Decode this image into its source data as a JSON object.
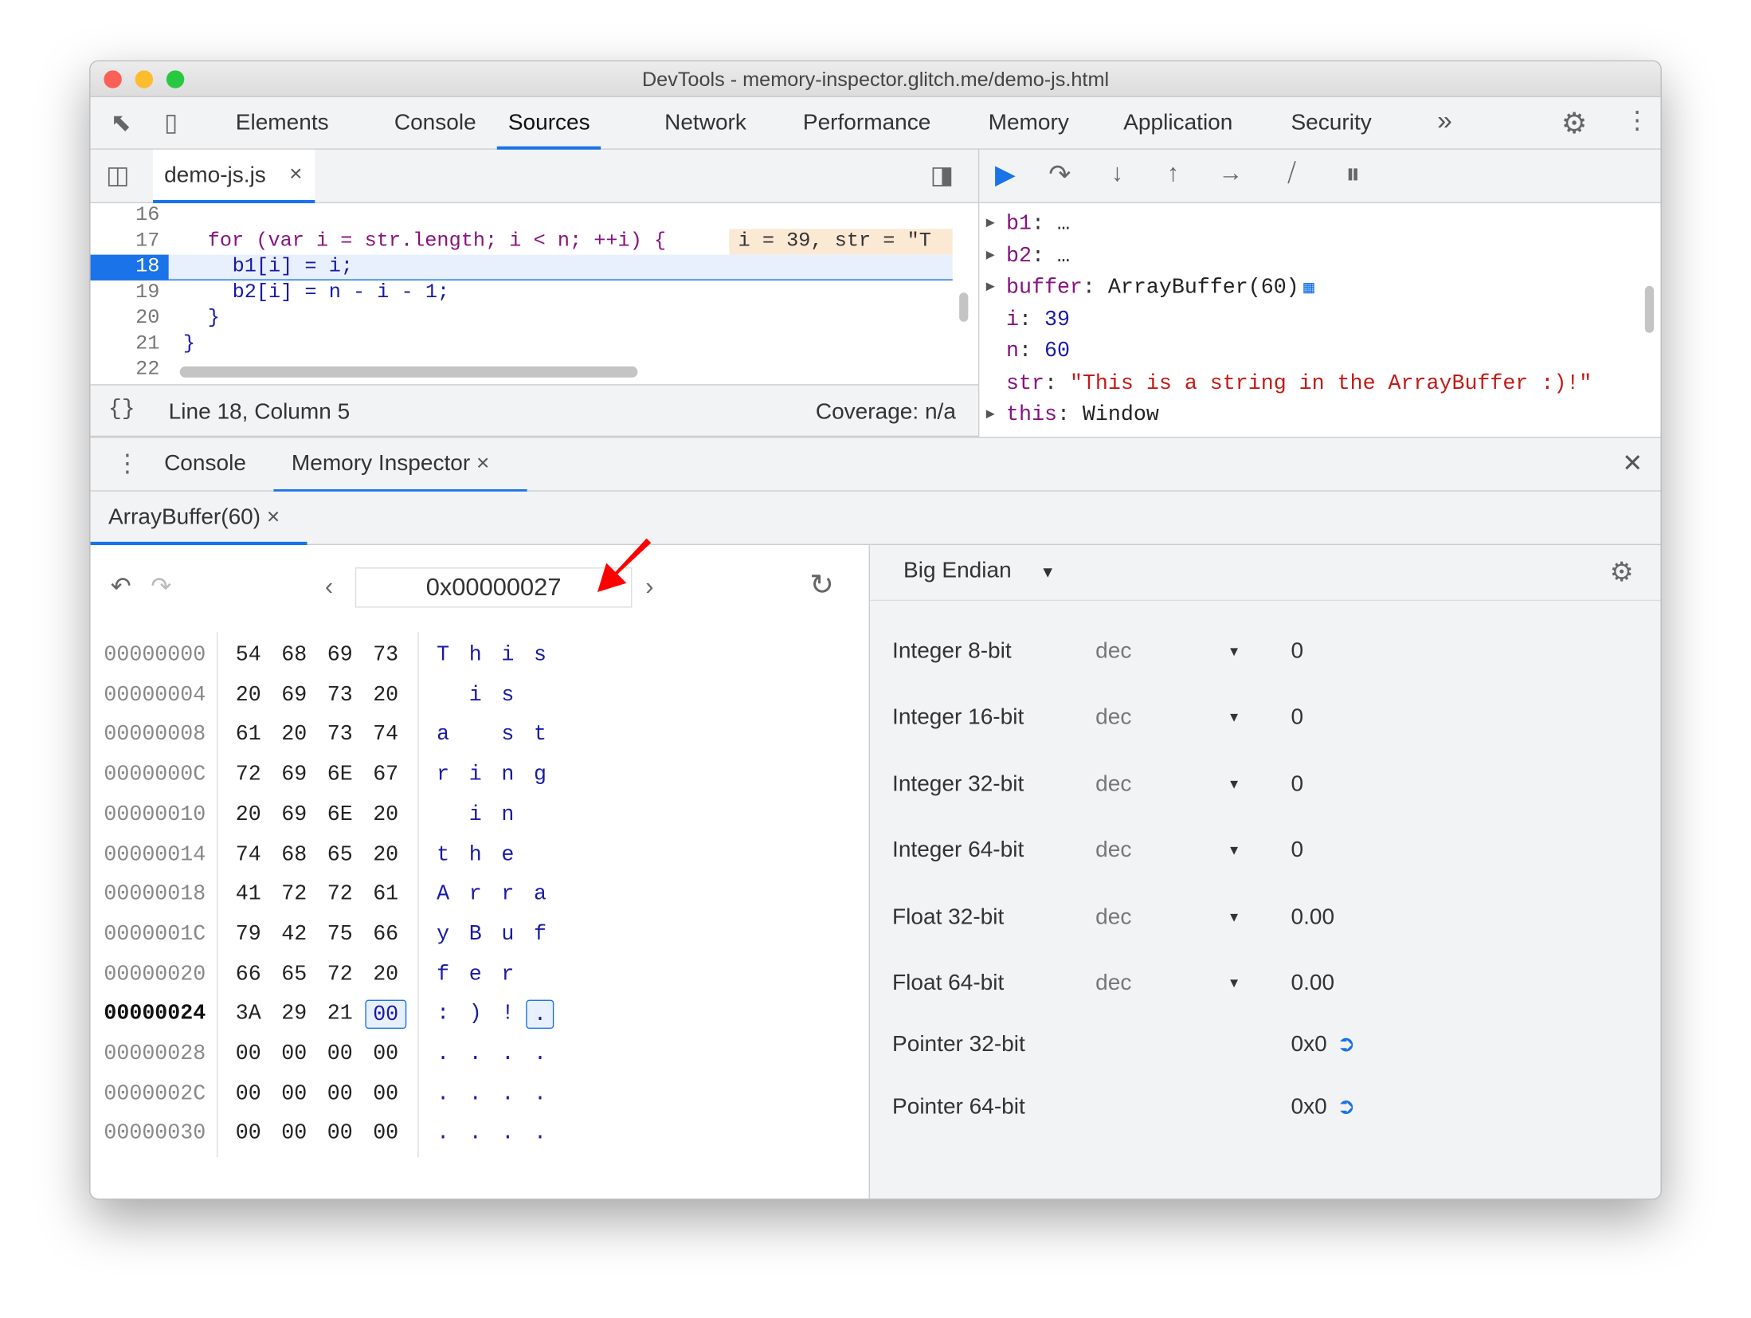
{
  "window": {
    "title": "DevTools - memory-inspector.glitch.me/demo-js.html"
  },
  "main_tabs": [
    {
      "label": "Elements"
    },
    {
      "label": "Console"
    },
    {
      "label": "Sources",
      "selected": true
    },
    {
      "label": "Network"
    },
    {
      "label": "Performance"
    },
    {
      "label": "Memory"
    },
    {
      "label": "Application"
    },
    {
      "label": "Security"
    }
  ],
  "more_tabs": "»",
  "editor": {
    "file_tab": "demo-js.js",
    "close": "×",
    "lines": [
      {
        "n": "16",
        "code": ""
      },
      {
        "n": "17",
        "code": "for (var i = str.length; i < n; ++i) {",
        "inline": "i = 39, str = \"T"
      },
      {
        "n": "18",
        "code": "b1[i] = i;",
        "active": true
      },
      {
        "n": "19",
        "code": "b2[i] = n - i - 1;"
      },
      {
        "n": "20",
        "code": "}"
      },
      {
        "n": "21",
        "code": "}"
      },
      {
        "n": "22",
        "code": ""
      }
    ],
    "status": {
      "format": "{}",
      "position": "Line 18, Column 5",
      "coverage": "Coverage: n/a"
    }
  },
  "scope": [
    {
      "key": "b1",
      "value": "…",
      "expandable": true
    },
    {
      "key": "b2",
      "value": "…",
      "expandable": true
    },
    {
      "key": "buffer",
      "value": "ArrayBuffer(60)",
      "expandable": true
    },
    {
      "key": "i",
      "value": "39"
    },
    {
      "key": "n",
      "value": "60"
    },
    {
      "key": "str",
      "value": "\"This is a string in the ArrayBuffer :)!\""
    },
    {
      "key": "this",
      "value": "Window",
      "expandable": true
    }
  ],
  "drawer": {
    "tabs": [
      {
        "label": "Console"
      },
      {
        "label": "Memory Inspector",
        "selected": true
      }
    ],
    "close": "×",
    "close_drawer": "✕"
  },
  "inspector": {
    "buffer_tab": "ArrayBuffer(60)",
    "address": "0x00000027",
    "rows": [
      {
        "addr": "00000000",
        "bytes": [
          "54",
          "68",
          "69",
          "73"
        ],
        "chars": [
          "T",
          "h",
          "i",
          "s"
        ]
      },
      {
        "addr": "00000004",
        "bytes": [
          "20",
          "69",
          "73",
          "20"
        ],
        "chars": [
          " ",
          "i",
          "s",
          " "
        ]
      },
      {
        "addr": "00000008",
        "bytes": [
          "61",
          "20",
          "73",
          "74"
        ],
        "chars": [
          "a",
          " ",
          "s",
          "t"
        ]
      },
      {
        "addr": "0000000C",
        "bytes": [
          "72",
          "69",
          "6E",
          "67"
        ],
        "chars": [
          "r",
          "i",
          "n",
          "g"
        ]
      },
      {
        "addr": "00000010",
        "bytes": [
          "20",
          "69",
          "6E",
          "20"
        ],
        "chars": [
          " ",
          "i",
          "n",
          " "
        ]
      },
      {
        "addr": "00000014",
        "bytes": [
          "74",
          "68",
          "65",
          "20"
        ],
        "chars": [
          "t",
          "h",
          "e",
          " "
        ]
      },
      {
        "addr": "00000018",
        "bytes": [
          "41",
          "72",
          "72",
          "61"
        ],
        "chars": [
          "A",
          "r",
          "r",
          "a"
        ]
      },
      {
        "addr": "0000001C",
        "bytes": [
          "79",
          "42",
          "75",
          "66"
        ],
        "chars": [
          "y",
          "B",
          "u",
          "f"
        ]
      },
      {
        "addr": "00000020",
        "bytes": [
          "66",
          "65",
          "72",
          "20"
        ],
        "chars": [
          "f",
          "e",
          "r",
          " "
        ]
      },
      {
        "addr": "00000024",
        "bytes": [
          "3A",
          "29",
          "21",
          "00"
        ],
        "chars": [
          ":",
          ")",
          "!",
          "."
        ],
        "current": true
      },
      {
        "addr": "00000028",
        "bytes": [
          "00",
          "00",
          "00",
          "00"
        ],
        "chars": [
          ".",
          ".",
          ".",
          "."
        ]
      },
      {
        "addr": "0000002C",
        "bytes": [
          "00",
          "00",
          "00",
          "00"
        ],
        "chars": [
          ".",
          ".",
          ".",
          "."
        ]
      },
      {
        "addr": "00000030",
        "bytes": [
          "00",
          "00",
          "00",
          "00"
        ],
        "chars": [
          ".",
          ".",
          ".",
          "."
        ]
      }
    ],
    "endianness": "Big Endian",
    "values": [
      {
        "label": "Integer 8-bit",
        "format": "dec",
        "value": "0"
      },
      {
        "label": "Integer 16-bit",
        "format": "dec",
        "value": "0"
      },
      {
        "label": "Integer 32-bit",
        "format": "dec",
        "value": "0"
      },
      {
        "label": "Integer 64-bit",
        "format": "dec",
        "value": "0"
      },
      {
        "label": "Float 32-bit",
        "format": "dec",
        "value": "0.00"
      },
      {
        "label": "Float 64-bit",
        "format": "dec",
        "value": "0.00"
      },
      {
        "label": "Pointer 32-bit",
        "value": "0x0",
        "link": true
      },
      {
        "label": "Pointer 64-bit",
        "value": "0x0",
        "link": true
      }
    ]
  },
  "colors": {
    "accent": "#1a73e8",
    "annotation_arrow": "#ff0000"
  }
}
